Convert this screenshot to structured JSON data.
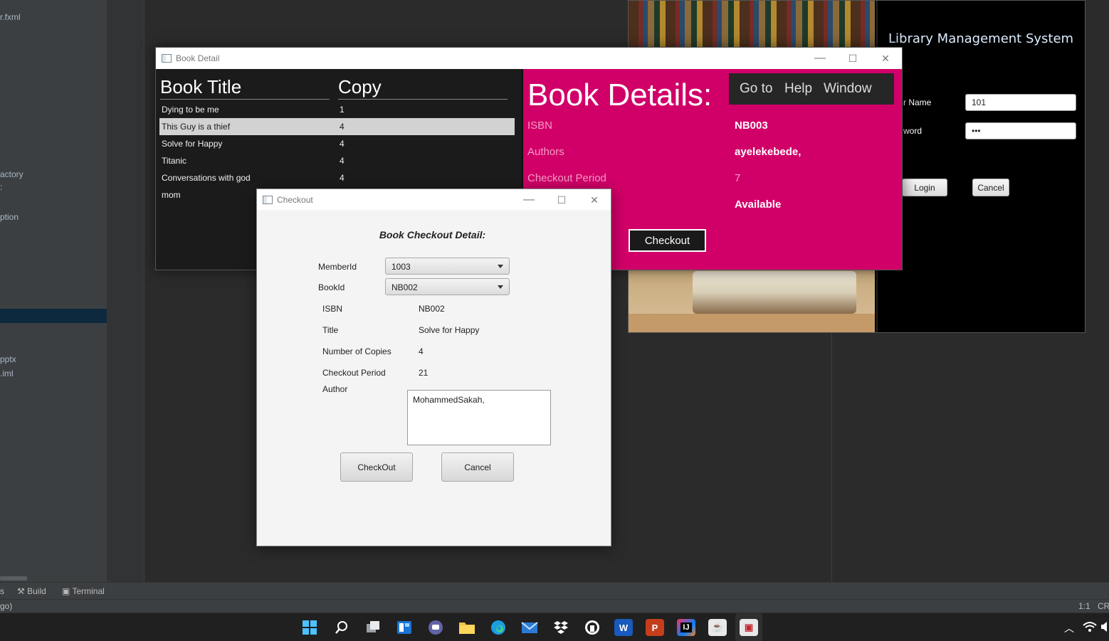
{
  "ide": {
    "files": [
      {
        "label": "r.fxml"
      },
      {
        "label": "actory"
      },
      {
        "label": ":"
      },
      {
        "label": "ption"
      },
      {
        "label": "pptx"
      },
      {
        "label": ".iml"
      }
    ],
    "bottom_tools": [
      "s",
      "Build",
      "Terminal"
    ],
    "status_left": "go)",
    "status_position": "1:1",
    "status_line_sep": "CR"
  },
  "login_window": {
    "title": "Library Management System",
    "username_label": "r Name",
    "username_value": "101",
    "password_label": "word",
    "password_value": "•••",
    "login_button": "Login",
    "cancel_button": "Cancel"
  },
  "book_detail_window": {
    "title": "Book Detail",
    "table": {
      "headers": [
        "Book Title",
        "Copy"
      ],
      "rows": [
        {
          "title": "Dying to be me",
          "copy": "1"
        },
        {
          "title": "This Guy is a thief",
          "copy": "4"
        },
        {
          "title": "Solve for Happy",
          "copy": "4"
        },
        {
          "title": "Titanic",
          "copy": "4"
        },
        {
          "title": "Conversations with god",
          "copy": "4"
        },
        {
          "title": "mom",
          "copy": ""
        }
      ],
      "selected_index": 1
    },
    "details": {
      "heading": "Book Details:",
      "menu": [
        "Go to",
        "Help",
        "Window"
      ],
      "isbn_label": "ISBN",
      "isbn_value": "NB003",
      "authors_label": "Authors",
      "authors_value": "ayelekebede,",
      "checkout_period_label": "Checkout Period",
      "checkout_period_value": "7",
      "status_value": "Available",
      "checkout_button": "Checkout"
    },
    "colors": {
      "accent": "#d10068",
      "dark": "#1b1b1b"
    }
  },
  "checkout_window": {
    "title": "Checkout",
    "heading": "Book Checkout Detail:",
    "member_id_label": "MemberId",
    "member_id_value": "1003",
    "book_id_label": "BookId",
    "book_id_value": "NB002",
    "fields": [
      {
        "label": "ISBN",
        "value": "NB002"
      },
      {
        "label": "Title",
        "value": "Solve for Happy"
      },
      {
        "label": "Number of Copies",
        "value": "4"
      },
      {
        "label": "Checkout Period",
        "value": "21"
      }
    ],
    "author_label": "Author",
    "author_value": "MohammedSakah,",
    "checkout_button": "CheckOut",
    "cancel_button": "Cancel"
  },
  "taskbar": {
    "icons": [
      "windows-start-icon",
      "search-icon",
      "task-view-icon",
      "widgets-icon",
      "teams-chat-icon",
      "file-explorer-icon",
      "edge-icon",
      "mail-icon",
      "dropbox-icon",
      "github-icon",
      "word-icon",
      "powerpoint-icon",
      "intellij-icon",
      "java-icon",
      "active-app-icon"
    ],
    "tray_icons": [
      "chevron-up-icon",
      "wifi-icon",
      "volume-icon"
    ]
  }
}
